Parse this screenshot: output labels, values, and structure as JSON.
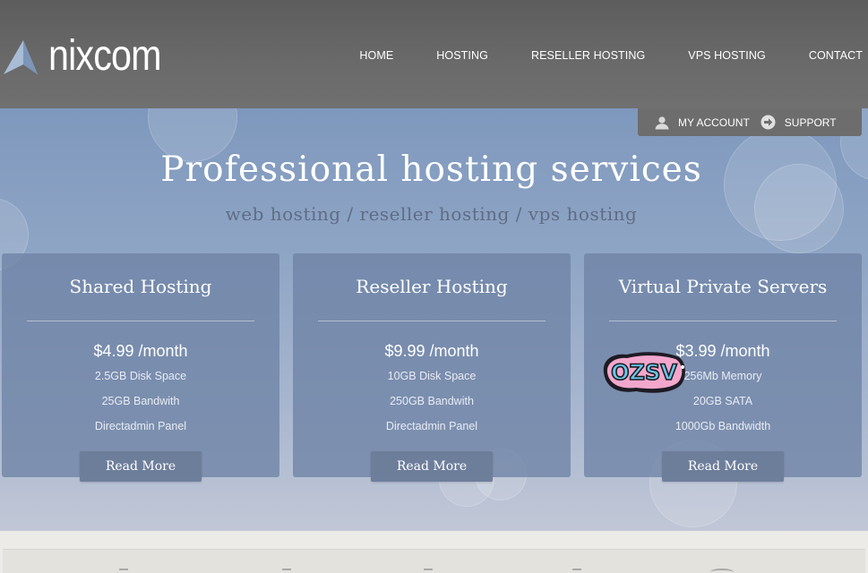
{
  "brand": {
    "name": "nixcom",
    "logo_icon": "triangle-logo-icon"
  },
  "nav": {
    "items": [
      {
        "label": "HOME"
      },
      {
        "label": "HOSTING"
      },
      {
        "label": "RESELLER HOSTING"
      },
      {
        "label": "VPS HOSTING"
      },
      {
        "label": "CONTACT"
      }
    ]
  },
  "account_bar": {
    "my_account": {
      "label": "MY ACCOUNT",
      "icon": "user-icon"
    },
    "support": {
      "label": "SUPPORT",
      "icon": "arrow-circle-icon"
    }
  },
  "hero": {
    "title": "Professional hosting services",
    "subtitle": "web hosting / reseller hosting / vps hosting"
  },
  "plans": [
    {
      "title": "Shared Hosting",
      "price": "$4.99 /month",
      "features": [
        "2.5GB Disk Space",
        "25GB Bandwith",
        "Directadmin Panel"
      ],
      "button": "Read More"
    },
    {
      "title": "Reseller Hosting",
      "price": "$9.99 /month",
      "features": [
        "10GB Disk Space",
        "250GB Bandwith",
        "Directadmin Panel"
      ],
      "button": "Read More"
    },
    {
      "title": "Virtual Private Servers",
      "price": "$3.99 /month",
      "features": [
        "256Mb Memory",
        "20GB SATA",
        "1000Gb Bandwidth"
      ],
      "button": "Read More"
    }
  ],
  "sticker": {
    "text": "OZSV"
  },
  "colors": {
    "header_bg": "#666666",
    "hero_top": "#7e98bd",
    "card_bg": "#6e83a5",
    "button_bg": "#6d7e9b",
    "subtitle": "#5e6d85"
  }
}
